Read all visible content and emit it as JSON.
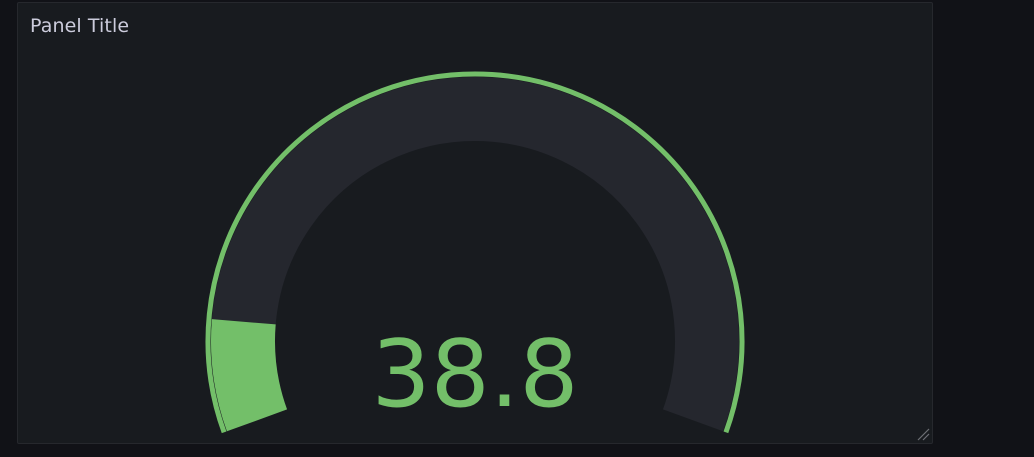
{
  "panel": {
    "title": "Panel Title"
  },
  "gauge": {
    "value": 38.8,
    "display_value": "38.8",
    "min": 0,
    "max": 100,
    "threshold_color": "#73bf69",
    "track_color": "#25272e",
    "value_color": "#73bf69"
  }
}
